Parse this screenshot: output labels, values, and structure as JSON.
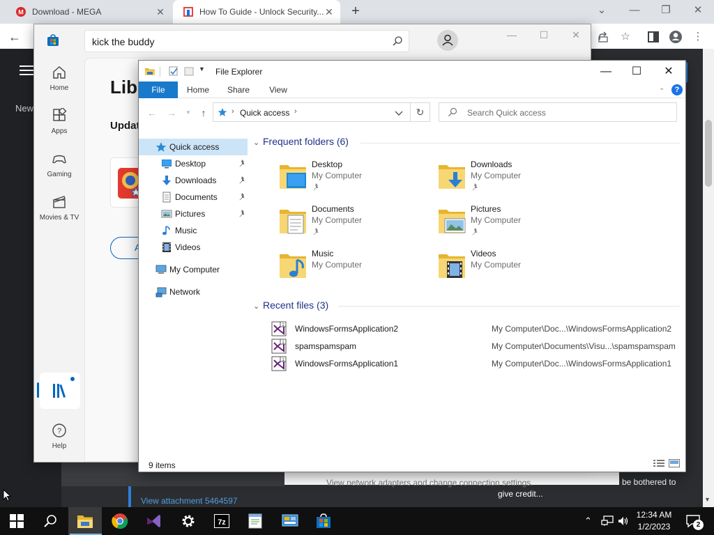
{
  "browser": {
    "tabs": [
      {
        "label": "Download - MEGA"
      },
      {
        "label": "How To Guide - Unlock Security..."
      }
    ],
    "new_tab": "+",
    "controls": {
      "dropdown": "⌄",
      "minimize": "—",
      "restore": "❐",
      "close": "✕"
    }
  },
  "page": {
    "new_label": "New",
    "attachment_link": "View attachment 5464597",
    "strip_text": "View network adapters and change connection settings.",
    "bothered_text": "be bothered to",
    "credit_text": "give credit..."
  },
  "store": {
    "search_value": "kick the buddy",
    "controls": {
      "minimize": "—",
      "maximize": "☐",
      "close": "✕"
    },
    "nav": [
      {
        "label": "Home",
        "icon": "home-icon"
      },
      {
        "label": "Apps",
        "icon": "apps-icon"
      },
      {
        "label": "Gaming",
        "icon": "gaming-icon"
      },
      {
        "label": "Movies & TV",
        "icon": "movies-icon"
      }
    ],
    "help_label": "Help",
    "library_title": "Libr",
    "updates_heading": "Updat",
    "action_button": "A"
  },
  "explorer": {
    "title": "File Explorer",
    "ribbon_tabs": [
      "File",
      "Home",
      "Share",
      "View"
    ],
    "address": "Quick access",
    "search_placeholder": "Search Quick access",
    "nav": {
      "quick_access": "Quick access",
      "pinned": [
        {
          "label": "Desktop",
          "pinned": true
        },
        {
          "label": "Downloads",
          "pinned": true
        },
        {
          "label": "Documents",
          "pinned": true
        },
        {
          "label": "Pictures",
          "pinned": true
        },
        {
          "label": "Music",
          "pinned": false
        },
        {
          "label": "Videos",
          "pinned": false
        }
      ],
      "my_computer": "My Computer",
      "network": "Network"
    },
    "frequent_header": "Frequent folders (6)",
    "frequent": [
      {
        "name": "Desktop",
        "location": "My Computer",
        "pinned": true,
        "icon": "desktop-folder-icon"
      },
      {
        "name": "Downloads",
        "location": "My Computer",
        "pinned": true,
        "icon": "downloads-folder-icon"
      },
      {
        "name": "Documents",
        "location": "My Computer",
        "pinned": true,
        "icon": "documents-folder-icon"
      },
      {
        "name": "Pictures",
        "location": "My Computer",
        "pinned": true,
        "icon": "pictures-folder-icon"
      },
      {
        "name": "Music",
        "location": "My Computer",
        "pinned": false,
        "icon": "music-folder-icon"
      },
      {
        "name": "Videos",
        "location": "My Computer",
        "pinned": false,
        "icon": "videos-folder-icon"
      }
    ],
    "recent_header": "Recent files (3)",
    "recent": [
      {
        "name": "WindowsFormsApplication2",
        "path": "My Computer\\Doc...\\WindowsFormsApplication2"
      },
      {
        "name": "spamspamspam",
        "path": "My Computer\\Documents\\Visu...\\spamspamspam"
      },
      {
        "name": "WindowsFormsApplication1",
        "path": "My Computer\\Doc...\\WindowsFormsApplication1"
      }
    ],
    "status_items": "9 items",
    "controls": {
      "minimize": "—",
      "maximize": "☐",
      "close": "✕"
    }
  },
  "taskbar": {
    "apps": [
      "start-icon",
      "search-icon",
      "file-explorer-icon",
      "chrome-icon",
      "visual-studio-icon",
      "settings-icon",
      "7zip-icon",
      "notepad-icon",
      "control-panel-icon",
      "store-icon"
    ],
    "time": "12:34 AM",
    "date": "1/2/2023",
    "notification_count": "2"
  }
}
